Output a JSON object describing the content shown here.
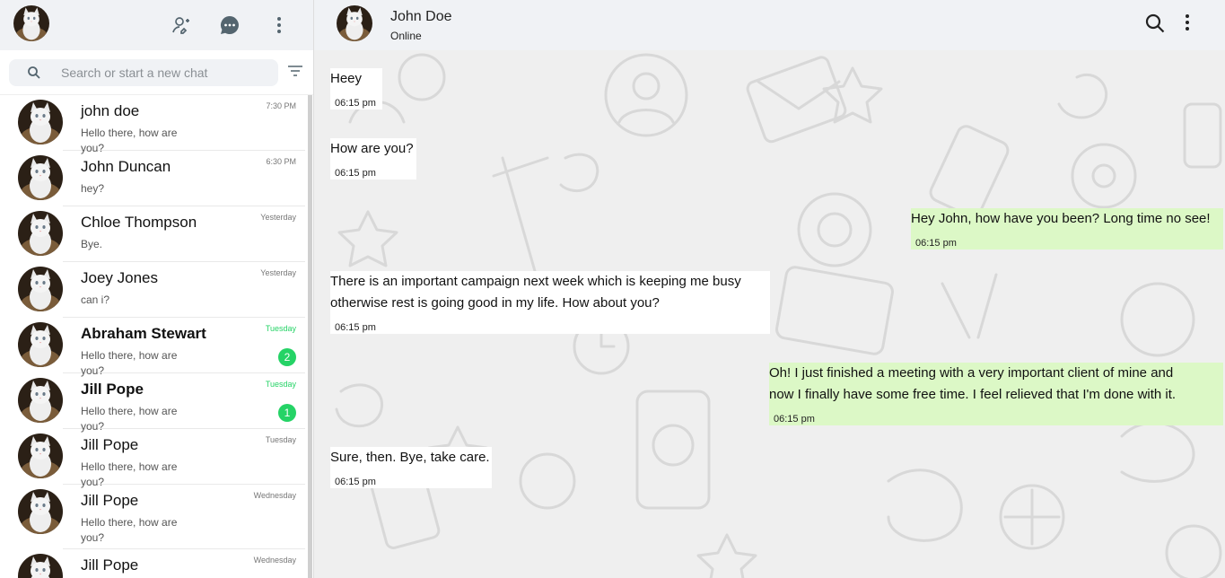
{
  "sidebar": {
    "search": {
      "placeholder": "Search or start a new chat"
    },
    "chats": [
      {
        "name": "john doe",
        "preview": "Hello there, how are you?",
        "time": "7:30 PM",
        "bold": false,
        "unread": ""
      },
      {
        "name": "John Duncan",
        "preview": "hey?",
        "time": "6:30 PM",
        "bold": false,
        "unread": ""
      },
      {
        "name": "Chloe Thompson",
        "preview": "Bye.",
        "time": "Yesterday",
        "bold": false,
        "unread": ""
      },
      {
        "name": "Joey Jones",
        "preview": "can i?",
        "time": "Yesterday",
        "bold": false,
        "unread": ""
      },
      {
        "name": "Abraham Stewart",
        "preview": "Hello there, how are you?",
        "time": "Tuesday",
        "bold": true,
        "unread": "2"
      },
      {
        "name": "Jill Pope",
        "preview": "Hello there, how are you?",
        "time": "Tuesday",
        "bold": true,
        "unread": "1"
      },
      {
        "name": "Jill Pope",
        "preview": "Hello there, how are you?",
        "time": "Tuesday",
        "bold": false,
        "unread": ""
      },
      {
        "name": "Jill Pope",
        "preview": "Hello there, how are you?",
        "time": "Wednesday",
        "bold": false,
        "unread": ""
      },
      {
        "name": "Jill Pope",
        "preview": "",
        "time": "Wednesday",
        "bold": false,
        "unread": ""
      }
    ]
  },
  "conversation": {
    "contact_name": "John Doe",
    "contact_status": "Online",
    "messages": [
      {
        "direction": "in",
        "lines": [
          "Heey"
        ],
        "time": "06:15 pm"
      },
      {
        "direction": "in",
        "lines": [
          "How are you?"
        ],
        "time": "06:15 pm"
      },
      {
        "direction": "out",
        "lines": [
          "Hey John, how have you been? Long time no see!"
        ],
        "time": "06:15 pm"
      },
      {
        "direction": "in",
        "lines": [
          "There is an important campaign next week which is keeping me busy",
          "otherwise rest is going good in my life. How about you?"
        ],
        "time": "06:15 pm"
      },
      {
        "direction": "out",
        "lines": [
          "Oh! I just finished a meeting with a very important client of mine and",
          "now I finally have some free time. I feel relieved that I'm done with it."
        ],
        "time": "06:15 pm"
      },
      {
        "direction": "in",
        "lines": [
          "Sure, then. Bye, take care."
        ],
        "time": "06:15 pm"
      }
    ]
  },
  "icons": {
    "header": [
      "new-contact-icon",
      "chat-bubble-icon",
      "menu-dots-icon"
    ],
    "search": "search-icon",
    "filter": "filter-icon",
    "conversation_header": [
      "search-icon",
      "menu-dots-icon"
    ]
  },
  "colors": {
    "header_bg": "#f0f2f5",
    "outgoing_bubble": "#dcf8c6",
    "incoming_bubble": "#ffffff",
    "unread_green": "#25d366",
    "wallpaper": "#efefef"
  }
}
